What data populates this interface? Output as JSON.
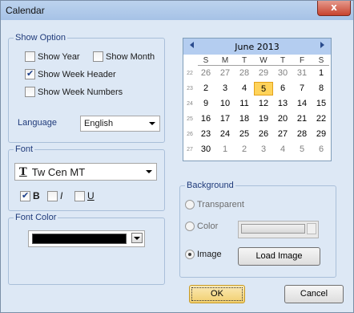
{
  "window": {
    "title": "Calendar",
    "close_glyph": "x"
  },
  "show_option": {
    "legend": "Show Option",
    "show_year": "Show Year",
    "show_month": "Show Month",
    "show_week_header": "Show Week Header",
    "show_week_numbers": "Show Week Numbers",
    "language_label": "Language",
    "language_value": "English"
  },
  "font": {
    "legend": "Font",
    "name": "Tw Cen MT",
    "bold": "B",
    "italic": "I",
    "underline": "U",
    "font_icon_glyph": "T"
  },
  "font_color": {
    "legend": "Font Color",
    "value_color": "#000000"
  },
  "calendar": {
    "month_label": "June 2013",
    "weekdays": [
      "S",
      "M",
      "T",
      "W",
      "T",
      "F",
      "S"
    ],
    "weeks": [
      {
        "num": "22",
        "days": [
          "26",
          "27",
          "28",
          "29",
          "30",
          "31",
          "1"
        ]
      },
      {
        "num": "23",
        "days": [
          "2",
          "3",
          "4",
          "5",
          "6",
          "7",
          "8"
        ]
      },
      {
        "num": "24",
        "days": [
          "9",
          "10",
          "11",
          "12",
          "13",
          "14",
          "15"
        ]
      },
      {
        "num": "25",
        "days": [
          "16",
          "17",
          "18",
          "19",
          "20",
          "21",
          "22"
        ]
      },
      {
        "num": "26",
        "days": [
          "23",
          "24",
          "25",
          "26",
          "27",
          "28",
          "29"
        ]
      },
      {
        "num": "27",
        "days": [
          "30",
          "1",
          "2",
          "3",
          "4",
          "5",
          "6"
        ]
      }
    ],
    "today": "5"
  },
  "background": {
    "legend": "Background",
    "transparent": "Transparent",
    "color": "Color",
    "image": "Image",
    "load_image": "Load Image"
  },
  "buttons": {
    "ok": "OK",
    "cancel": "Cancel"
  }
}
